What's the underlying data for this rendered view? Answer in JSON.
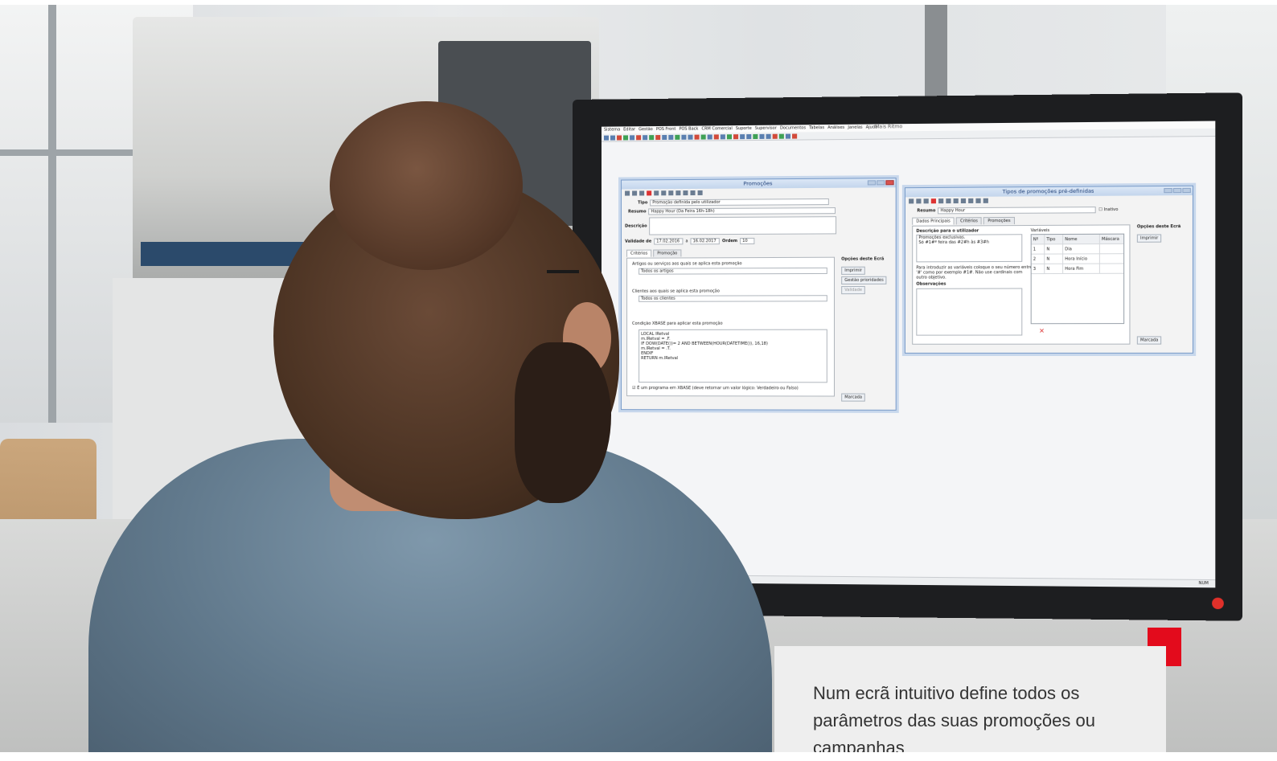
{
  "caption": {
    "text": "Num ecrã intuitivo define todos os parâmetros das suas promoções ou campanhas"
  },
  "colors": {
    "accent": "#e30b1c",
    "caption_bg": "#eeeeee",
    "caption_text": "#333333"
  },
  "screen": {
    "app_title": "Mais Ritmo",
    "menu": [
      "Sistema",
      "Editar",
      "Gestão",
      "POS Front",
      "POS Back",
      "CRM Comercial",
      "Suporte",
      "Supervisor",
      "Documentos",
      "Tabelas",
      "Análises",
      "Janelas",
      "Ajuda"
    ],
    "status_right": "NUM",
    "promocoes": {
      "title": "Promoções",
      "tipo_label": "Tipo",
      "tipo_value": "Promoção definida pelo utilizador",
      "resumo_label": "Resumo",
      "resumo_value": "Happy Hour (Da Feira 16h-18h)",
      "descricao_label": "Descrição",
      "validade_label": "Validade de",
      "validade_from": "17.02.2016",
      "validade_sep": "a",
      "validade_to": "16.02.2017",
      "ordem_label": "Ordem",
      "ordem_value": "10",
      "tabs": [
        "Critérios",
        "Promoção"
      ],
      "artigos_label": "Artigos ou serviços aos quais se aplica esta promoção",
      "artigos_value": "Todos os artigos",
      "clientes_label": "Clientes aos quais se aplica esta promoção",
      "clientes_value": "Todos os clientes",
      "condicao_label": "Condição XBASE para aplicar esta promoção",
      "code_lines": [
        "LOCAL lRetval",
        "m.lRetval = .F.",
        "IF DOW(DATE())= 2 AND BETWEEN(HOUR(DATETIME()), 16,18)",
        "m.lRetval = .T.",
        "ENDIF",
        "RETURN m.lRetval"
      ],
      "checkbox_label": "É um programa em XBASE (deve retornar um valor lógico: Verdadeiro ou Falso)",
      "opcoes_label": "Opções deste Ecrã",
      "btn_imprimir": "Imprimir",
      "btn_gestao": "Gestão prioridades",
      "btn_validar": "Validade",
      "btn_marcada": "Marcada"
    },
    "tipos": {
      "title": "Tipos de promoções pré-definidas",
      "resumo_label": "Resumo",
      "resumo_value": "Happy Hour",
      "inativo_label": "Inativo",
      "tabs": [
        "Dados Principais",
        "Critérios",
        "Promoções"
      ],
      "descricao_label": "Descrição para o utilizador",
      "descricao_lines": [
        "Promoções exclusivas.",
        "Só #1#ª feira das #2#h às #3#h"
      ],
      "help_lines": [
        "Para introduzir as variáveis coloque o seu número entre",
        "'#' como por exemplo #1#. Não use cardinais com",
        "outro objetivo."
      ],
      "observacoes_label": "Observações",
      "variaveis_label": "Variáveis",
      "grid_headers": [
        "Nº",
        "Tipo",
        "Nome",
        "Máscara"
      ],
      "grid_rows": [
        {
          "n": "1",
          "tipo": "N",
          "nome": "Dia"
        },
        {
          "n": "2",
          "tipo": "N",
          "nome": "Hora Início"
        },
        {
          "n": "3",
          "tipo": "N",
          "nome": "Hora Fim"
        }
      ],
      "opcoes_label": "Opções deste Ecrã",
      "btn_imprimir": "Imprimir",
      "btn_marcada": "Marcada"
    }
  }
}
